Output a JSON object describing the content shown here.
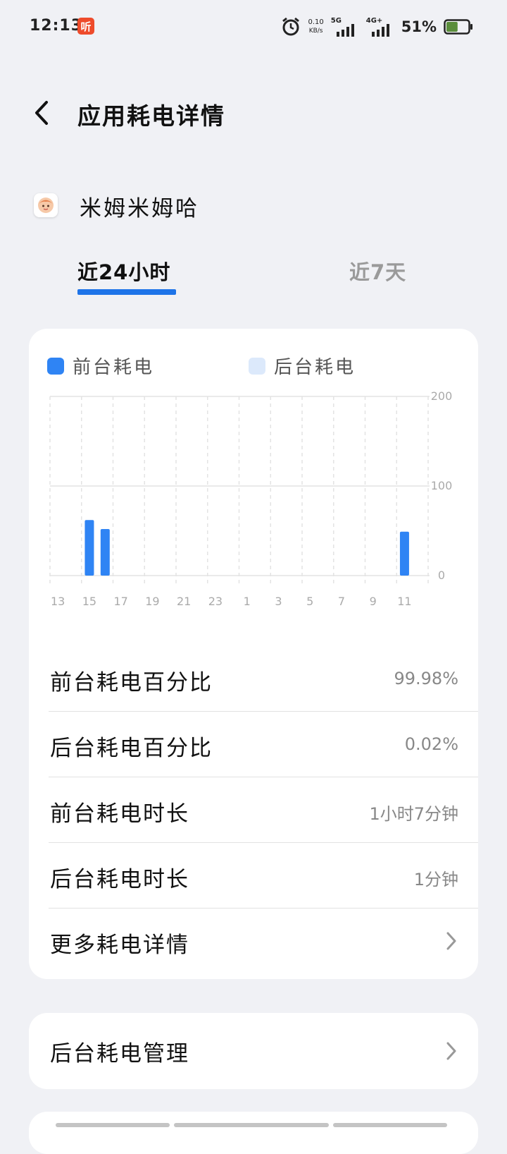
{
  "status_bar": {
    "time": "12:13",
    "app_badge": "听",
    "net_speed_value": "0.10",
    "net_speed_unit": "KB/s",
    "signal_5g_label": "5G",
    "signal_4g_label": "4G+",
    "battery_percent": "51%",
    "battery_level": 0.51
  },
  "header": {
    "title": "应用耗电详情"
  },
  "app": {
    "name": "米姆米姆哈"
  },
  "tabs": [
    {
      "label": "近24小时",
      "active": true
    },
    {
      "label": "近7天",
      "active": false
    }
  ],
  "legend": {
    "foreground": "前台耗电",
    "background": "后台耗电"
  },
  "colors": {
    "accent": "#1e74e8",
    "foreground_bar": "#2f84f4",
    "background_bar": "#dce9fb"
  },
  "chart_data": {
    "type": "bar",
    "categories": [
      "13",
      "14",
      "15",
      "16",
      "17",
      "18",
      "19",
      "20",
      "21",
      "22",
      "23",
      "0",
      "1",
      "2",
      "3",
      "4",
      "5",
      "6",
      "7",
      "8",
      "9",
      "10",
      "11",
      "12"
    ],
    "x_tick_labels": [
      "13",
      "15",
      "17",
      "19",
      "21",
      "23",
      "1",
      "3",
      "5",
      "7",
      "9",
      "11"
    ],
    "series": [
      {
        "name": "前台耗电",
        "values": [
          0,
          0,
          62,
          52,
          0,
          0,
          0,
          0,
          0,
          0,
          0,
          0,
          0,
          0,
          0,
          0,
          0,
          0,
          0,
          0,
          0,
          0,
          49,
          0
        ]
      },
      {
        "name": "后台耗电",
        "values": [
          0,
          0,
          0,
          0,
          0,
          0,
          0,
          0,
          0,
          0,
          0,
          0,
          0,
          0,
          0,
          0,
          0,
          0,
          0,
          0,
          0,
          0,
          0,
          0
        ]
      }
    ],
    "y_ticks": [
      "200",
      "100",
      "0"
    ],
    "ylim": [
      0,
      200
    ],
    "grid": true,
    "legend_position": "top"
  },
  "stats": [
    {
      "label": "前台耗电百分比",
      "value": "99.98%"
    },
    {
      "label": "后台耗电百分比",
      "value": "0.02%"
    },
    {
      "label": "前台耗电时长",
      "value": "1小时7分钟"
    },
    {
      "label": "后台耗电时长",
      "value": "1分钟"
    },
    {
      "label": "更多耗电详情",
      "value": ""
    }
  ],
  "manage": {
    "label": "后台耗电管理"
  }
}
